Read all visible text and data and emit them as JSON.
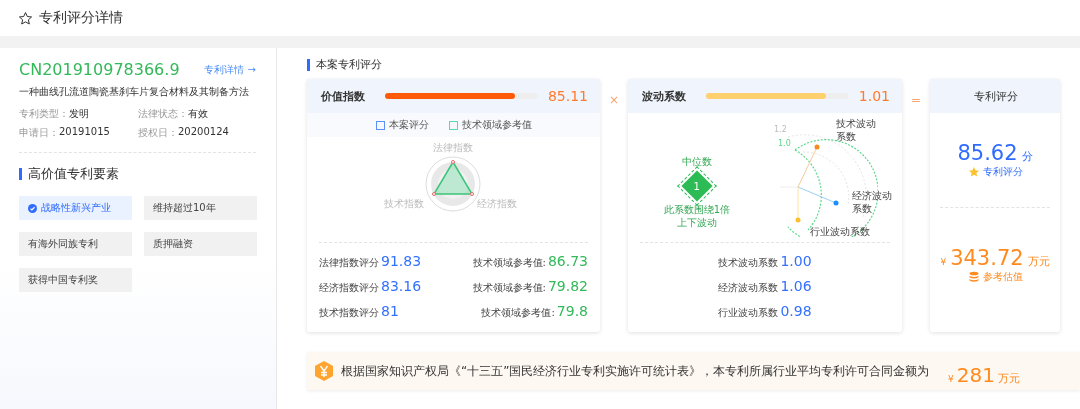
{
  "header": {
    "title": "专利评分详情"
  },
  "patent": {
    "number": "CN201910978366.9",
    "detail_link": "专利详情 →",
    "title": "一种曲线孔流道陶瓷基刹车片复合材料及其制备方法",
    "fields": [
      {
        "label": "专利类型：",
        "value": "发明"
      },
      {
        "label": "法律状态：",
        "value": "有效"
      },
      {
        "label": "申请日：",
        "value": "20191015"
      },
      {
        "label": "授权日：",
        "value": "20200124"
      }
    ]
  },
  "elements": {
    "title": "高价值专利要素",
    "tags": [
      {
        "label": "战略性新兴产业",
        "selected": true
      },
      {
        "label": "维持超过10年",
        "selected": false
      },
      {
        "label": "有海外同族专利",
        "selected": false
      },
      {
        "label": "质押融资",
        "selected": false
      },
      {
        "label": "获得中国专利奖",
        "selected": false
      }
    ]
  },
  "score_section": {
    "title": "本案专利评分",
    "value_index": {
      "label": "价值指数",
      "level": 0.85,
      "value": "85.11",
      "legend": [
        {
          "label": "本案评分",
          "color": "#5b8ff9"
        },
        {
          "label": "技术领域参考值",
          "color": "#5ad8a6"
        }
      ],
      "radar_labels": [
        "法律指数",
        "经济指数",
        "技术指数"
      ],
      "rows": [
        {
          "label": "法律指数评分",
          "value": "91.83",
          "ref_label": "技术领域参考值:",
          "ref_value": "86.73"
        },
        {
          "label": "经济指数评分",
          "value": "83.16",
          "ref_label": "技术领域参考值:",
          "ref_value": "79.82"
        },
        {
          "label": "技术指数评分",
          "value": "81",
          "ref_label": "技术领域参考值:",
          "ref_value": "79.8"
        }
      ]
    },
    "operator_1": "×",
    "fluctuation": {
      "label": "波动系数",
      "level": 0.84,
      "value": "1.01",
      "median": {
        "title": "中位数",
        "value": "1",
        "note": "此系数围绕1倍上下波动"
      },
      "chart_ticks": [
        "1.2",
        "1.0"
      ],
      "chart_labels": [
        "技术波动系数",
        "经济波动系数",
        "行业波动系数"
      ],
      "rows": [
        {
          "label": "技术波动系数",
          "value": "1.00"
        },
        {
          "label": "经济波动系数",
          "value": "1.06"
        },
        {
          "label": "行业波动系数",
          "value": "0.98"
        }
      ]
    },
    "operator_2": "=",
    "result": {
      "title": "专利评分",
      "score": "85.62",
      "score_unit": "分",
      "score_label": "专利评分",
      "currency": "¥",
      "amount": "343.72",
      "amount_unit": "万元",
      "amount_label": "参考估值"
    }
  },
  "banner": {
    "text": "根据国家知识产权局《“十三五”国民经济行业专利实施许可统计表》，本专利所属行业平均专利许可合同金额为",
    "currency": "¥",
    "amount": "281",
    "unit": "万元"
  }
}
